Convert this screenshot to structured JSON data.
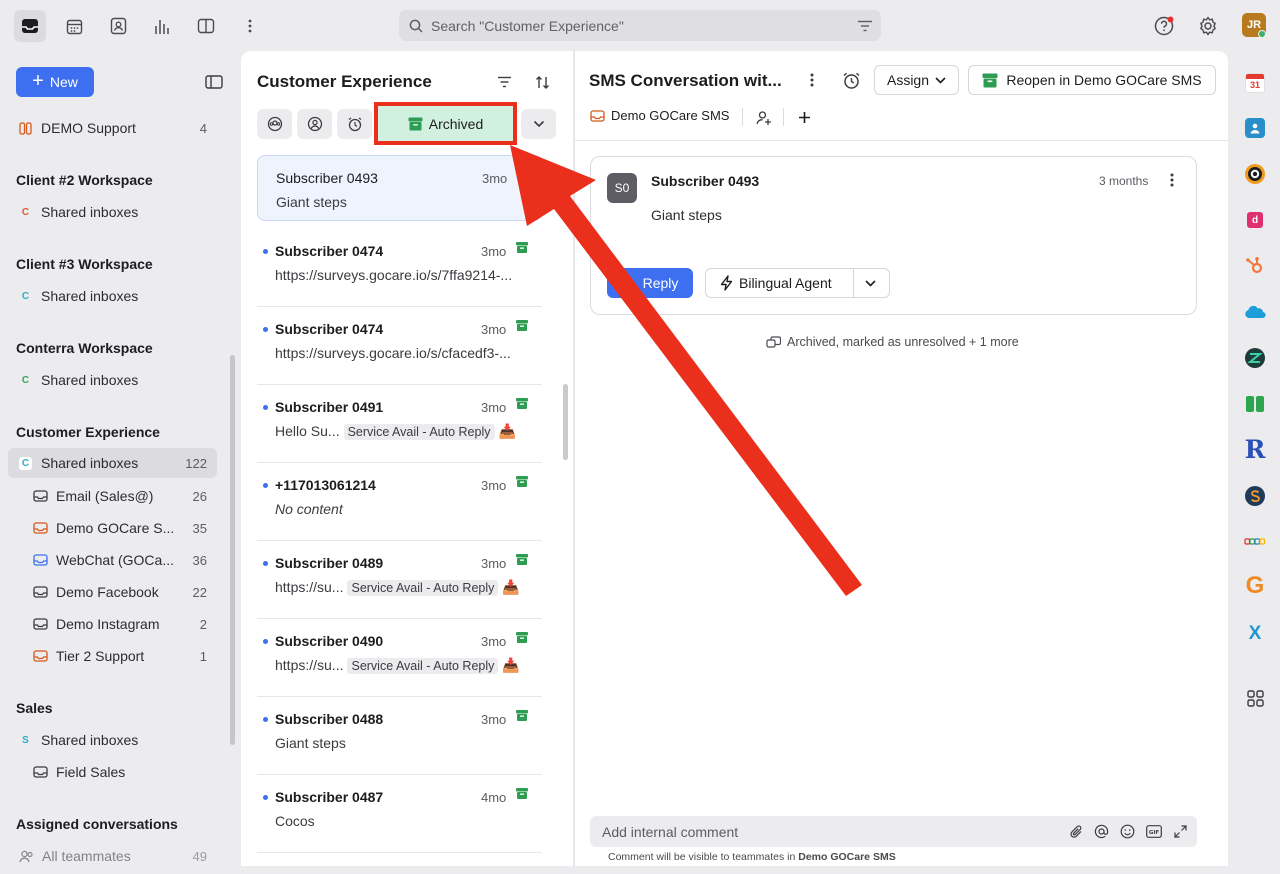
{
  "topbar": {
    "search_placeholder": "Search \"Customer Experience\"",
    "avatar_initials": "JR"
  },
  "sidebar": {
    "new_label": "New",
    "demo_support": {
      "label": "DEMO Support",
      "count": "4"
    },
    "sections": [
      {
        "title": "Client #2 Workspace",
        "badge": "C",
        "badge_color": "#e2572c",
        "item": "Shared inboxes"
      },
      {
        "title": "Client #3 Workspace",
        "badge": "C",
        "badge_color": "#2bb0c6",
        "item": "Shared inboxes"
      },
      {
        "title": "Conterra Workspace",
        "badge": "C",
        "badge_color": "#33a65a",
        "item": "Shared inboxes"
      }
    ],
    "customer_experience": {
      "title": "Customer Experience",
      "shared": {
        "badge": "C",
        "label": "Shared inboxes",
        "count": "122"
      },
      "inboxes": [
        {
          "label": "Email (Sales@)",
          "count": "26",
          "icon_color": "#3b3b40"
        },
        {
          "label": "Demo GOCare S...",
          "count": "35",
          "icon_color": "#d45a1c"
        },
        {
          "label": "WebChat (GOCa...",
          "count": "36",
          "icon_color": "#3d6ff0"
        },
        {
          "label": "Demo Facebook",
          "count": "22",
          "icon_color": "#3b3b40"
        },
        {
          "label": "Demo Instagram",
          "count": "2",
          "icon_color": "#3b3b40"
        },
        {
          "label": "Tier 2 Support",
          "count": "1",
          "icon_color": "#d45a1c"
        }
      ]
    },
    "sales": {
      "title": "Sales",
      "shared": {
        "badge": "S",
        "label": "Shared inboxes"
      },
      "field": {
        "label": "Field Sales"
      }
    },
    "assigned": {
      "title": "Assigned conversations",
      "teammates": {
        "label": "All teammates",
        "count": "49"
      }
    }
  },
  "list": {
    "title": "Customer Experience",
    "archived_label": "Archived",
    "conversations": [
      {
        "name": "Subscriber 0493",
        "time": "3mo",
        "preview": "Giant steps",
        "tag": "",
        "selected": true
      },
      {
        "name": "Subscriber 0474",
        "time": "3mo",
        "preview": "https://surveys.gocare.io/s/7ffa9214-...",
        "tag": ""
      },
      {
        "name": "Subscriber 0474",
        "time": "3mo",
        "preview": "https://surveys.gocare.io/s/cfacedf3-...",
        "tag": ""
      },
      {
        "name": "Subscriber 0491",
        "time": "3mo",
        "preview": "Hello Su...",
        "tag": "Service Avail - Auto Reply"
      },
      {
        "name": "+117013061214",
        "time": "3mo",
        "preview": "No content",
        "tag": ""
      },
      {
        "name": "Subscriber 0489",
        "time": "3mo",
        "preview": "https://su...",
        "tag": "Service Avail - Auto Reply"
      },
      {
        "name": "Subscriber 0490",
        "time": "3mo",
        "preview": "https://su...",
        "tag": "Service Avail - Auto Reply"
      },
      {
        "name": "Subscriber 0488",
        "time": "3mo",
        "preview": "Giant steps",
        "tag": ""
      },
      {
        "name": "Subscriber 0487",
        "time": "4mo",
        "preview": "Cocos",
        "tag": ""
      }
    ]
  },
  "conversation": {
    "title": "SMS Conversation wit...",
    "assign_label": "Assign",
    "reopen_label": "Reopen in Demo GOCare SMS",
    "inbox_label": "Demo GOCare SMS",
    "message": {
      "avatar": "S0",
      "sender": "Subscriber 0493",
      "time": "3 months",
      "body": "Giant steps"
    },
    "reply_label": "Reply",
    "agent_label": "Bilingual Agent",
    "activity": "Archived, marked as unresolved + 1 more",
    "comment_placeholder": "Add internal comment",
    "comment_note_prefix": "Comment will be visible to teammates in ",
    "comment_note_inbox": "Demo GOCare SMS"
  },
  "rail": {
    "calendar_day": "31",
    "r_letter": "R",
    "g_letter": "G",
    "x_letter": "X"
  },
  "colors": {
    "accent": "#3d6ff0",
    "archived_bg": "#d2f0e0",
    "archive_green": "#2e9d54",
    "annotation_red": "#ea2f1c"
  }
}
